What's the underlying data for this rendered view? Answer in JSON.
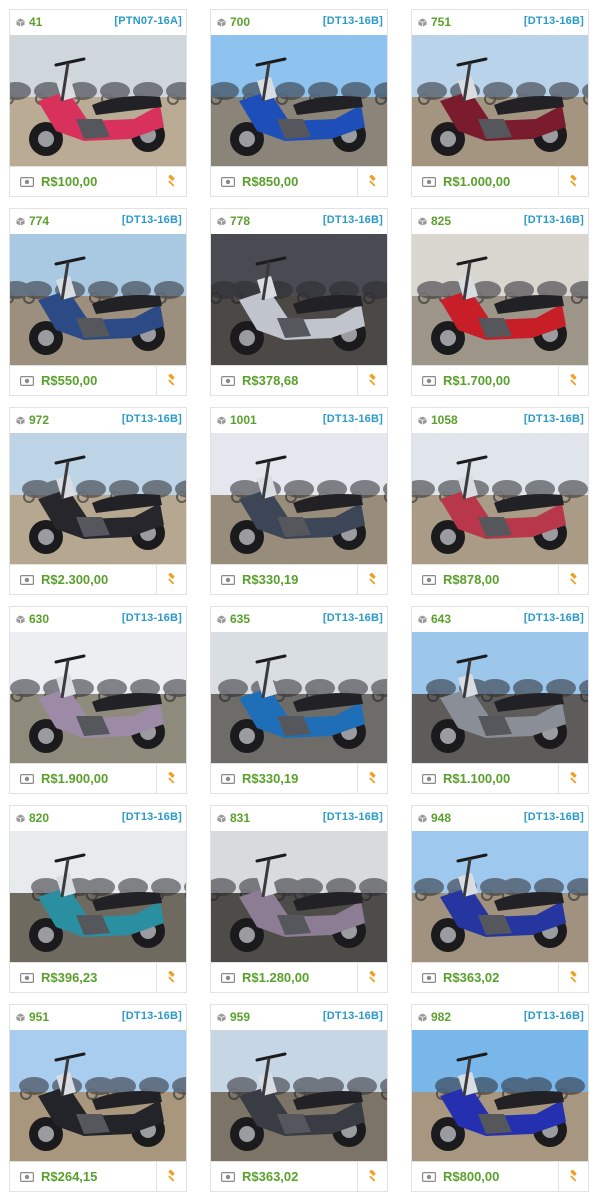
{
  "colors": {
    "accent_green": "#5aa02c",
    "code_blue": "#2a9ac9",
    "bid_orange": "#f0a020",
    "border": "#e2e2e2"
  },
  "icons": {
    "lot": "box-icon",
    "price": "money-icon",
    "bid": "gavel-icon"
  },
  "lots": [
    {
      "number": "41",
      "code": "[PTN07-16A]",
      "price": "R$100,00",
      "body": "#d8315b",
      "sky": "#cfd6dc",
      "ground": "#b9ab94"
    },
    {
      "number": "700",
      "code": "[DT13-16B]",
      "price": "R$850,00",
      "body": "#1e4fb8",
      "sky": "#8dc3ee",
      "ground": "#8a8479"
    },
    {
      "number": "751",
      "code": "[DT13-16B]",
      "price": "R$1.000,00",
      "body": "#7a1c2e",
      "sky": "#b9d4ea",
      "ground": "#a49580"
    },
    {
      "number": "774",
      "code": "[DT13-16B]",
      "price": "R$550,00",
      "body": "#2c4b86",
      "sky": "#a9c9e3",
      "ground": "#9c8f7e"
    },
    {
      "number": "778",
      "code": "[DT13-16B]",
      "price": "R$378,68",
      "body": "#c0c4cc",
      "sky": "#4a4a52",
      "ground": "#4b4846"
    },
    {
      "number": "825",
      "code": "[DT13-16B]",
      "price": "R$1.700,00",
      "body": "#c81e28",
      "sky": "#d9d6d0",
      "ground": "#9e9589"
    },
    {
      "number": "972",
      "code": "[DT13-16B]",
      "price": "R$2.300,00",
      "body": "#26262c",
      "sky": "#bcd4e6",
      "ground": "#b6a890"
    },
    {
      "number": "1001",
      "code": "[DT13-16B]",
      "price": "R$330,19",
      "body": "#3c4656",
      "sky": "#e4e8ee",
      "ground": "#988d7b"
    },
    {
      "number": "1058",
      "code": "[DT13-16B]",
      "price": "R$878,00",
      "body": "#b8374a",
      "sky": "#dfe5ea",
      "ground": "#a99b86"
    },
    {
      "number": "630",
      "code": "[DT13-16B]",
      "price": "R$1.900,00",
      "body": "#9c8aa6",
      "sky": "#eceef2",
      "ground": "#8e8a7c"
    },
    {
      "number": "635",
      "code": "[DT13-16B]",
      "price": "R$330,19",
      "body": "#1f6fb8",
      "sky": "#d9dee3",
      "ground": "#6e6c68"
    },
    {
      "number": "643",
      "code": "[DT13-16B]",
      "price": "R$1.100,00",
      "body": "#8a8e96",
      "sky": "#9cc6ea",
      "ground": "#5e5c5a"
    },
    {
      "number": "820",
      "code": "[DT13-16B]",
      "price": "R$396,23",
      "body": "#2a8fa0",
      "sky": "#e8ebee",
      "ground": "#6f6a60"
    },
    {
      "number": "831",
      "code": "[DT13-16B]",
      "price": "R$1.280,00",
      "body": "#8c7c94",
      "sky": "#d8dadc",
      "ground": "#4e4c48"
    },
    {
      "number": "948",
      "code": "[DT13-16B]",
      "price": "R$363,02",
      "body": "#2636a0",
      "sky": "#9fc8ee",
      "ground": "#a0927e"
    },
    {
      "number": "951",
      "code": "[DT13-16B]",
      "price": "R$264,15",
      "body": "#22242a",
      "sky": "#a8cdee",
      "ground": "#a8977c"
    },
    {
      "number": "959",
      "code": "[DT13-16B]",
      "price": "R$363,02",
      "body": "#3a3c44",
      "sky": "#c6d6e4",
      "ground": "#7c7466"
    },
    {
      "number": "982",
      "code": "[DT13-16B]",
      "price": "R$800,00",
      "body": "#2430b0",
      "sky": "#79b7ea",
      "ground": "#a89780"
    }
  ]
}
